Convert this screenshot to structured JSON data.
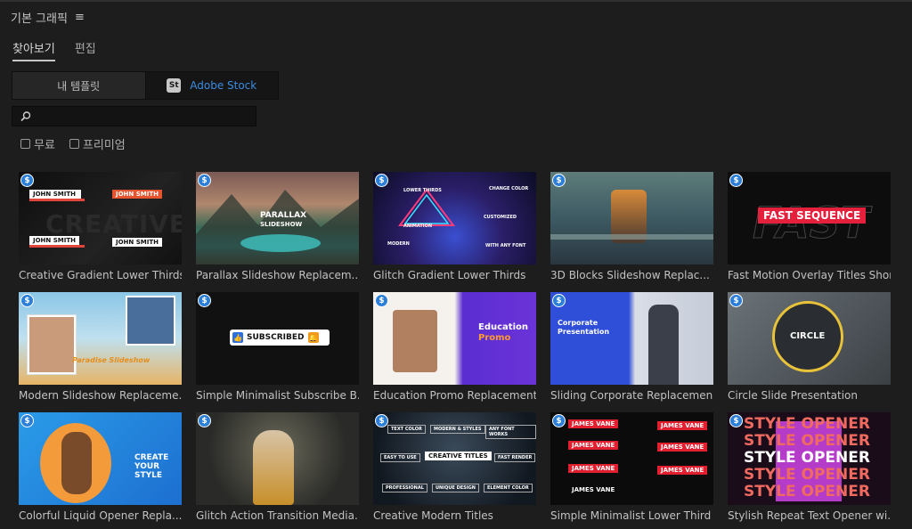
{
  "panel": {
    "title": "기본 그래픽",
    "menu_icon": "hamburger-menu-icon"
  },
  "tabs": [
    {
      "label": "찾아보기",
      "active": true
    },
    {
      "label": "편집",
      "active": false
    }
  ],
  "source_toggle": {
    "my_templates": "내 템플릿",
    "adobe_stock_badge": "St",
    "adobe_stock": "Adobe Stock",
    "selected": "Adobe Stock"
  },
  "search": {
    "placeholder": "",
    "value": ""
  },
  "filters": [
    {
      "label": "무료",
      "checked": false
    },
    {
      "label": "프리미엄",
      "checked": false
    }
  ],
  "accent_color": "#3b8de0",
  "badge_color": "#2c7fd8",
  "templates": [
    {
      "title": "Creative Gradient Lower Thirds",
      "thumb": {
        "lines": [
          "JOHN SMITH",
          "JOHN SMITH",
          "JOHN SMITH",
          "JOHN SMITH"
        ],
        "bg": "CREATIVE"
      }
    },
    {
      "title": "Parallax Slideshow Replacem...",
      "thumb": {
        "lines": [
          "PARALLAX",
          "SLIDESHOW"
        ]
      }
    },
    {
      "title": "Glitch Gradient Lower Thirds",
      "thumb": {
        "lines": [
          "LOWER THIRDS",
          "CHANGE COLOR",
          "ANIMATION",
          "CUSTOMIZED",
          "MODERN",
          "WITH ANY FONT"
        ]
      }
    },
    {
      "title": "3D Blocks Slideshow Replac...",
      "thumb": {
        "lines": []
      }
    },
    {
      "title": "Fast Motion Overlay Titles Shor...",
      "thumb": {
        "lines": [
          "FAST SEQUENCE"
        ],
        "bg": "FAST"
      }
    },
    {
      "title": "Modern Slideshow Replaceme...",
      "thumb": {
        "lines": [
          "Paradise Slideshow"
        ]
      }
    },
    {
      "title": "Simple Minimalist Subscribe B...",
      "thumb": {
        "lines": [
          "SUBSCRIBED"
        ]
      }
    },
    {
      "title": "Education Promo Replacement...",
      "thumb": {
        "lines": [
          "Education",
          "Promo"
        ]
      }
    },
    {
      "title": "Sliding Corporate Replacemen...",
      "thumb": {
        "lines": [
          "Corporate",
          "Presentation"
        ]
      }
    },
    {
      "title": "Circle Slide Presentation",
      "thumb": {
        "lines": [
          "CIRCLE"
        ]
      }
    },
    {
      "title": "Colorful Liquid Opener Repla...",
      "thumb": {
        "lines": [
          "CREATE",
          "YOUR STYLE"
        ]
      }
    },
    {
      "title": "Glitch Action Transition Media...",
      "thumb": {
        "lines": []
      }
    },
    {
      "title": "Creative Modern Titles",
      "thumb": {
        "lines": [
          "TEXT COLOR",
          "MODERN & STYLES",
          "ANY FONT WORKS",
          "EASY TO USE",
          "CREATIVE TITLES",
          "FAST RENDER",
          "PROFESSIONAL",
          "UNIQUE DESIGN",
          "ELEMENT COLOR"
        ]
      }
    },
    {
      "title": "Simple Minimalist Lower Third",
      "thumb": {
        "lines": [
          "JAMES VANE",
          "JAMES VANE",
          "JAMES VANE",
          "JAMES VANE",
          "JAMES VANE",
          "JAMES VANE",
          "JAMES VANE"
        ]
      }
    },
    {
      "title": "Stylish Repeat Text Opener wi...",
      "thumb": {
        "lines": [
          "STYLE OPENER",
          "STYLE OPENER",
          "STYLE OPENER",
          "STYLE OPENER",
          "STYLE OPENER"
        ]
      }
    }
  ]
}
